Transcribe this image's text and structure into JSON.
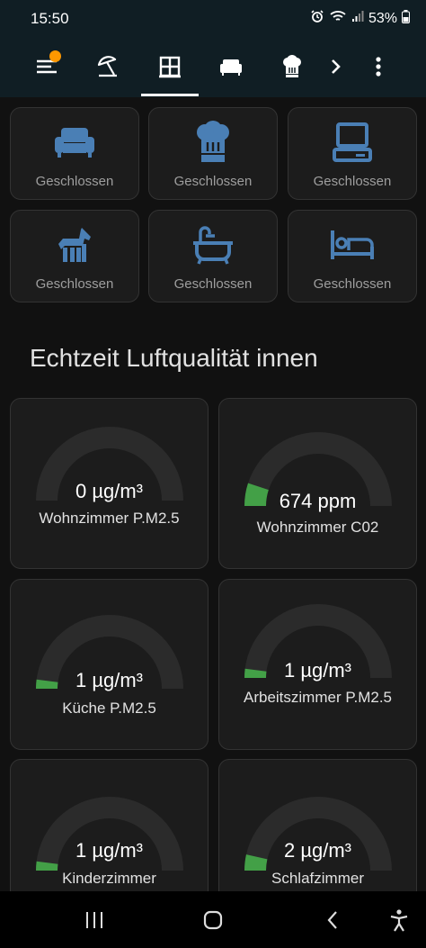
{
  "status_bar": {
    "time": "15:50",
    "battery": "53%"
  },
  "toolbar": {
    "icons": [
      "menu-icon",
      "umbrella-beach-icon",
      "window-icon",
      "sofa-icon",
      "chef-hat-icon",
      "chevron-right-icon",
      "more-vert-icon"
    ],
    "active_tab": "window-icon",
    "badge_color": "#ff9800"
  },
  "windows": [
    {
      "icon": "sofa-icon",
      "state": "Geschlossen"
    },
    {
      "icon": "chef-hat-icon",
      "state": "Geschlossen"
    },
    {
      "icon": "desktop-icon",
      "state": "Geschlossen"
    },
    {
      "icon": "horse-icon",
      "state": "Geschlossen"
    },
    {
      "icon": "bathtub-icon",
      "state": "Geschlossen"
    },
    {
      "icon": "bed-icon",
      "state": "Geschlossen"
    }
  ],
  "air_quality": {
    "title": "Echtzeit Luftqualität innen",
    "gauges": [
      {
        "value": "0 µg/m³",
        "name": "Wohnzimmer P.M2.5",
        "level": 0.0
      },
      {
        "value": "674 ppm",
        "name": "Wohnzimmer C02",
        "level": 0.1
      },
      {
        "value": "1 µg/m³",
        "name": "Küche P.M2.5",
        "level": 0.04
      },
      {
        "value": "1 µg/m³",
        "name": "Arbeitszimmer P.M2.5",
        "level": 0.04
      },
      {
        "value": "1 µg/m³",
        "name": "Kinderzimmer",
        "level": 0.04
      },
      {
        "value": "2 µg/m³",
        "name": "Schlafzimmer",
        "level": 0.07
      }
    ]
  },
  "colors": {
    "accent_icon": "#4a7fb5",
    "gauge_fill": "#43a047",
    "gauge_track": "#2b2b2b",
    "toolbar_bg": "#101e24"
  }
}
